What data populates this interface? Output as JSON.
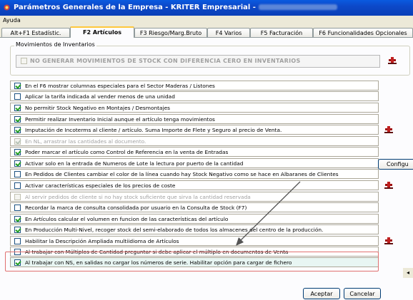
{
  "window": {
    "title": "Parámetros Generales de la Empresa - KRITER Empresarial -"
  },
  "menu": {
    "items": [
      "Ayuda"
    ]
  },
  "tabs": [
    {
      "label": "Alt+F1 Estadístic."
    },
    {
      "label": "F2 Artículos",
      "active": true
    },
    {
      "label": "F3 Riesgo/Marg.Bruto"
    },
    {
      "label": "F4 Varios"
    },
    {
      "label": "F5 Facturación"
    },
    {
      "label": "F6 Funcionalidades Opcionales"
    }
  ],
  "inventory_group": {
    "title": "Movimientos de Inventarios",
    "option": "NO GENERAR MOVIMIENTOS DE STOCK CON DIFERENCIA CERO EN INVENTARIOS"
  },
  "options": [
    {
      "label": "En el F6 mostrar columnas especiales para el Sector Maderas / Listones",
      "checked": true,
      "disabled": false
    },
    {
      "label": "Aplicar la tarifa indicada al vender menos de una unidad",
      "checked": false,
      "disabled": false
    },
    {
      "label": "No permitir Stock Negativo en Montajes / Desmontajes",
      "checked": true,
      "disabled": false
    },
    {
      "label": "Permitir realizar Inventario Inicial aunque el artículo tenga movimientos",
      "checked": true,
      "disabled": false
    },
    {
      "label": "Imputación de Incoterms al cliente / artículo.  Suma Importe de Flete y Seguro al precio de Venta.",
      "checked": true,
      "disabled": false
    },
    {
      "label": "En NL, arrastrar las cantidades al documento.",
      "checked": true,
      "disabled": true
    },
    {
      "label": "Poder marcar el artículo como Control de Referencia en la venta de Entradas",
      "checked": true,
      "disabled": false
    },
    {
      "label": "Activar solo en la entrada de Numeros de Lote la lectura por puerto de la cantidad",
      "checked": true,
      "disabled": false
    },
    {
      "label": "En Pedidos de Clientes cambiar el color de la línea cuando hay Stock Negativo como se hace en Albaranes de Clientes",
      "checked": false,
      "disabled": false
    },
    {
      "label": "Activar características especiales de los precios de coste",
      "checked": false,
      "disabled": false
    },
    {
      "label": "Al servir pedidos de cliente si no hay stock suficiente que sirva la cantidad reservada",
      "checked": false,
      "disabled": true
    },
    {
      "label": "Recordar la marca de consulta consolidada por usuario en la Consulta de Stock (F7)",
      "checked": false,
      "disabled": false
    },
    {
      "label": "En Artículos calcular el volumen en funcion de las características del artículo",
      "checked": true,
      "disabled": false
    },
    {
      "label": "En Producción Multi-Nivel, recoger stock del semi-elaborado de todos los almacenes del centro de la producción.",
      "checked": true,
      "disabled": false
    },
    {
      "label": "Habilitar la Descripción Ampliada multiidioma de Artículos",
      "checked": false,
      "disabled": false
    },
    {
      "label": "Al trabajar con Múltiplos de Cantidad preguntar si debe aplicar el múltiplo en documentos de Venta",
      "checked": false,
      "disabled": false
    },
    {
      "label": "Al trabajar con NS, en salidas no cargar los números de serie. Habilitar opción para cargar de fichero",
      "checked": true,
      "disabled": false,
      "highlighted": true
    }
  ],
  "buttons": {
    "configure": "Configu",
    "accept": "Aceptar",
    "cancel": "Cancelar"
  },
  "colors": {
    "titlebar": "#0a48c8",
    "highlight_border": "#e07070",
    "arrow": "#555555"
  }
}
